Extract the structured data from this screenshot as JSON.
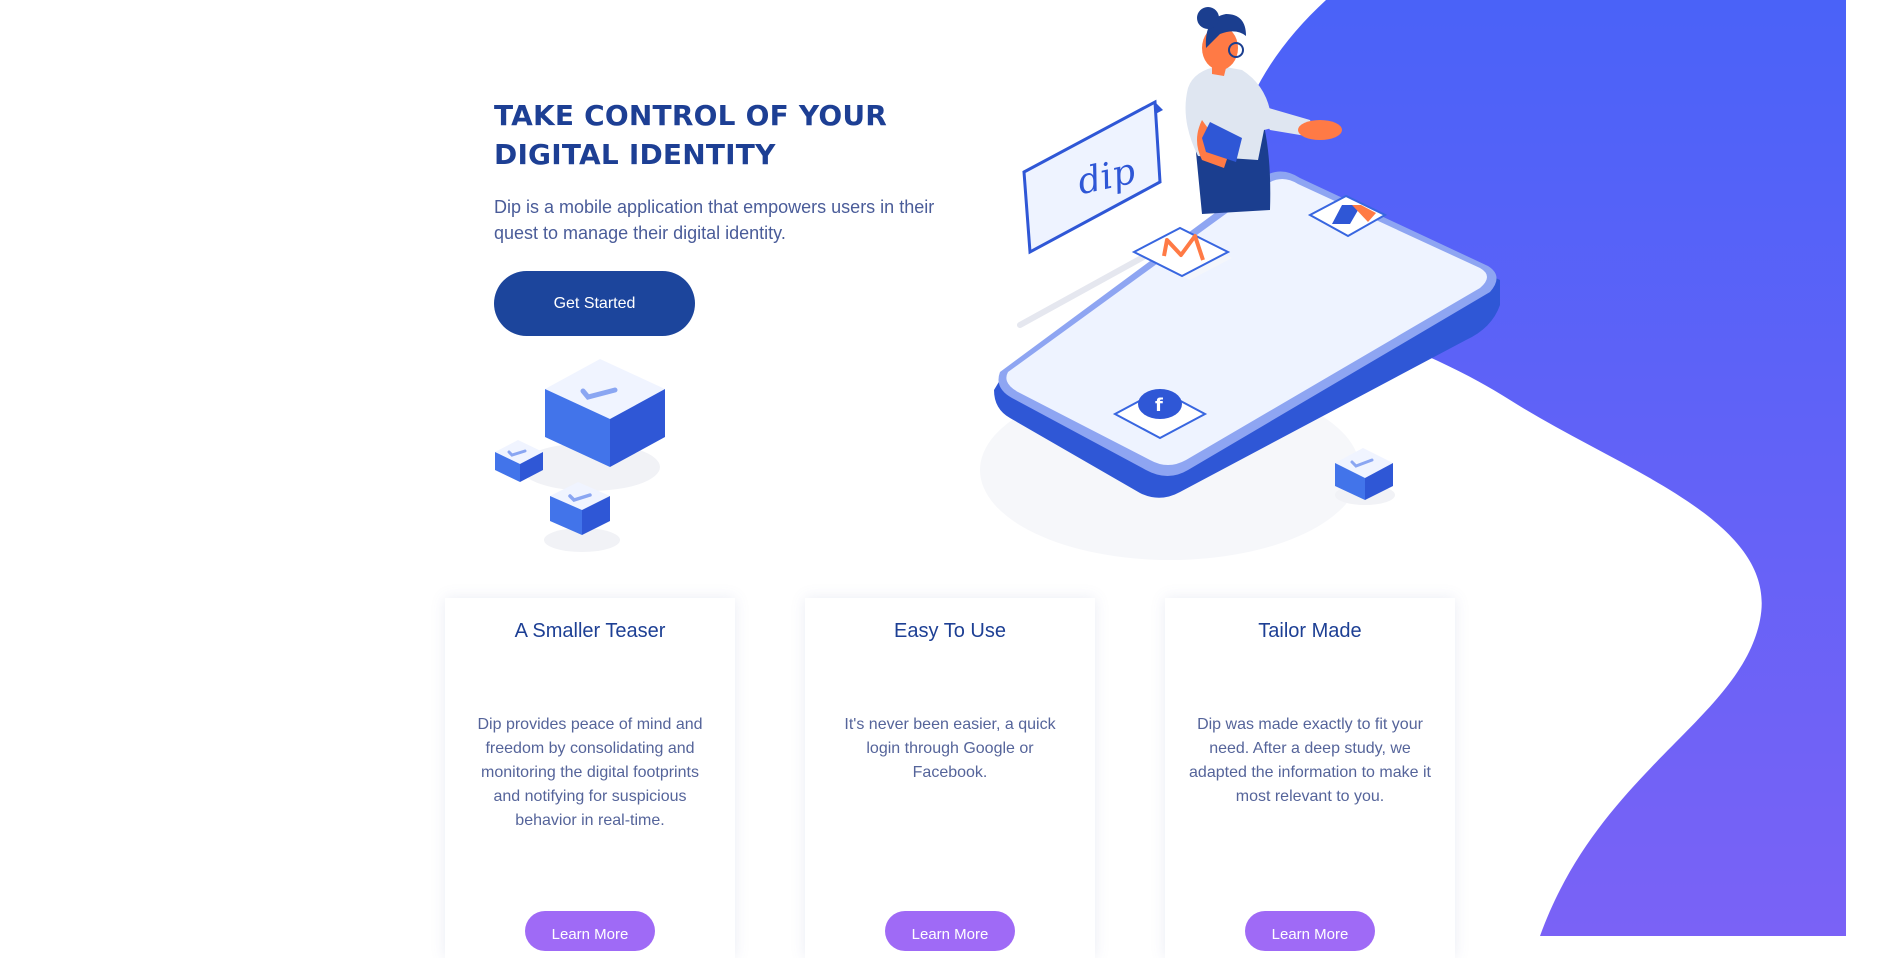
{
  "hero": {
    "title_line1": "TAKE CONTROL OF YOUR",
    "title_line2": "DIGITAL IDENTITY",
    "subtitle": "Dip is a mobile application that empowers users in their quest to manage their digital identity.",
    "cta_label": "Get Started"
  },
  "illustration": {
    "sign_text": "dip",
    "facebook_letter": "f"
  },
  "features": [
    {
      "title": "A Smaller Teaser",
      "text": "Dip provides peace of mind and freedom by consolidating and monitoring the digital footprints and notifying for suspicious behavior in real-time.",
      "button": "Learn More"
    },
    {
      "title": "Easy To Use",
      "text": "It's never been easier, a quick login through Google or Facebook.",
      "button": "Learn More"
    },
    {
      "title": "Tailor Made",
      "text": "Dip was made exactly to fit your need. After a deep study, we adapted the information to make it most relevant to you.",
      "button": "Learn More"
    }
  ],
  "colors": {
    "brand_navy": "#1c459c",
    "wave_top": "#4a62f8",
    "wave_bottom": "#7a62f6",
    "learn_more": "#9f6af6"
  }
}
